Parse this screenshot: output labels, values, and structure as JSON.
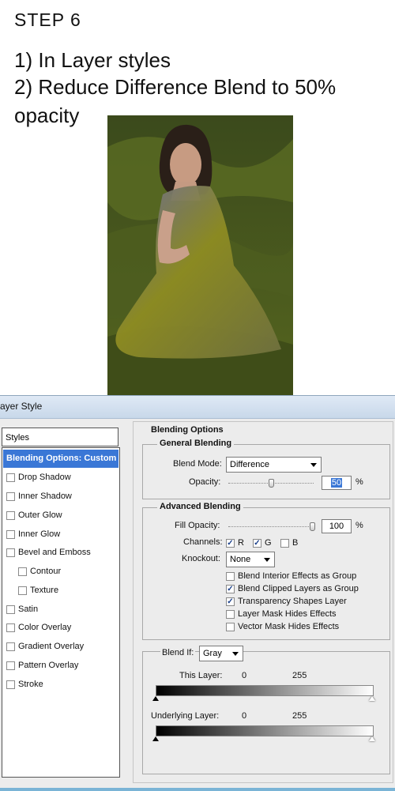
{
  "tutorial": {
    "step_title": "STEP  6",
    "line1": "1) In Layer styles",
    "line2": "2) Reduce Difference Blend to 50%",
    "line3": "opacity"
  },
  "dialog": {
    "title": "ayer Style",
    "styles_header": "Styles",
    "selected_style": "Blending Options: Custom",
    "style_items": [
      {
        "label": "Drop Shadow",
        "checked": false
      },
      {
        "label": "Inner Shadow",
        "checked": false
      },
      {
        "label": "Outer Glow",
        "checked": false
      },
      {
        "label": "Inner Glow",
        "checked": false
      },
      {
        "label": "Bevel and Emboss",
        "checked": false
      },
      {
        "label": "Contour",
        "checked": false
      },
      {
        "label": "Texture",
        "checked": false
      },
      {
        "label": "Satin",
        "checked": false
      },
      {
        "label": "Color Overlay",
        "checked": false
      },
      {
        "label": "Gradient Overlay",
        "checked": false
      },
      {
        "label": "Pattern Overlay",
        "checked": false
      },
      {
        "label": "Stroke",
        "checked": false
      }
    ],
    "blending_options": {
      "heading": "Blending Options",
      "general_title": "General Blending",
      "blend_mode_label": "Blend Mode:",
      "blend_mode_value": "Difference",
      "opacity_label": "Opacity:",
      "opacity_value": "50",
      "opacity_unit": "%",
      "advanced_title": "Advanced Blending",
      "fill_opacity_label": "Fill Opacity:",
      "fill_opacity_value": "100",
      "fill_opacity_unit": "%",
      "channels_label": "Channels:",
      "channels": [
        {
          "label": "R",
          "checked": true
        },
        {
          "label": "G",
          "checked": true
        },
        {
          "label": "B",
          "checked": false
        }
      ],
      "knockout_label": "Knockout:",
      "knockout_value": "None",
      "options": [
        {
          "label": "Blend Interior Effects as Group",
          "checked": false
        },
        {
          "label": "Blend Clipped Layers as Group",
          "checked": true
        },
        {
          "label": "Transparency Shapes Layer",
          "checked": true
        },
        {
          "label": "Layer Mask Hides Effects",
          "checked": false
        },
        {
          "label": "Vector Mask Hides Effects",
          "checked": false
        }
      ],
      "blend_if_label": "Blend If:",
      "blend_if_value": "Gray",
      "this_layer_label": "This Layer:",
      "this_layer_min": "0",
      "this_layer_max": "255",
      "underlying_layer_label": "Underlying Layer:",
      "underlying_layer_min": "0",
      "underlying_layer_max": "255"
    }
  },
  "colors": {
    "selection": "#3a77d6",
    "checkmark": "#1a3f8a",
    "grass": "#4c5a22",
    "cloth_yellow": "#8a8a1a",
    "cloth_blue": "#6a6a8a"
  }
}
